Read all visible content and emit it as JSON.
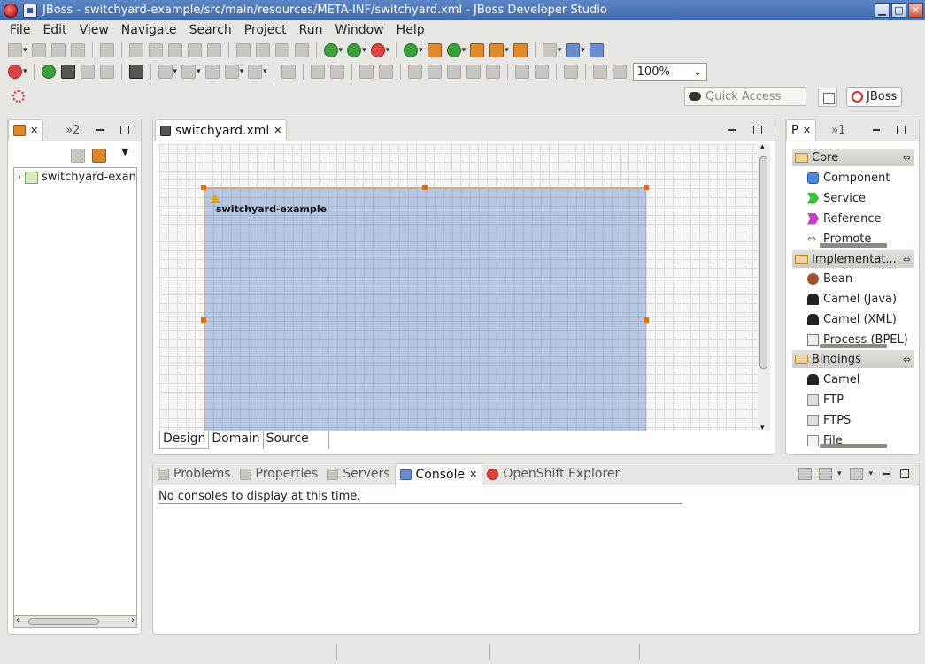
{
  "window": {
    "title": "JBoss - switchyard-example/src/main/resources/META-INF/switchyard.xml - JBoss Developer Studio",
    "minimize": "▁",
    "maximize": "□",
    "close": "✕"
  },
  "menu": {
    "items": [
      "File",
      "Edit",
      "View",
      "Navigate",
      "Search",
      "Project",
      "Run",
      "Window",
      "Help"
    ]
  },
  "toolbar": {
    "zoom_value": "100%",
    "zoom_arrow": "⌄"
  },
  "quick_access": {
    "placeholder": "Quick Access"
  },
  "perspective": {
    "label": "JBoss"
  },
  "explorer": {
    "overflow_label": "»2",
    "tree": [
      {
        "label": "switchyard-exan",
        "arrow": "›"
      }
    ]
  },
  "editor": {
    "tab_title": "switchyard.xml",
    "composite_label": "switchyard-example",
    "bottom_tabs": [
      "Design",
      "Domain",
      "Source"
    ],
    "close_glyph": "✕"
  },
  "palette": {
    "tab_label": "P",
    "overflow_label": "»1",
    "drawers": [
      {
        "label": "Core",
        "entries": [
          "Component",
          "Service",
          "Reference",
          "Promote"
        ]
      },
      {
        "label": "Implementat...",
        "entries": [
          "Bean",
          "Camel (Java)",
          "Camel (XML)",
          "Process (BPEL)"
        ]
      },
      {
        "label": "Bindings",
        "entries": [
          "Camel",
          "FTP",
          "FTPS",
          "File"
        ]
      }
    ],
    "drawer_arrow": "⇔"
  },
  "console": {
    "tabs": [
      "Problems",
      "Properties",
      "Servers",
      "Console",
      "OpenShift Explorer"
    ],
    "active_tab": "Console",
    "message": "No consoles to display at this time."
  },
  "colors": {
    "titlebar": "#4a76b8",
    "composite_fill": "#a5bade",
    "handle": "#e06a10"
  }
}
